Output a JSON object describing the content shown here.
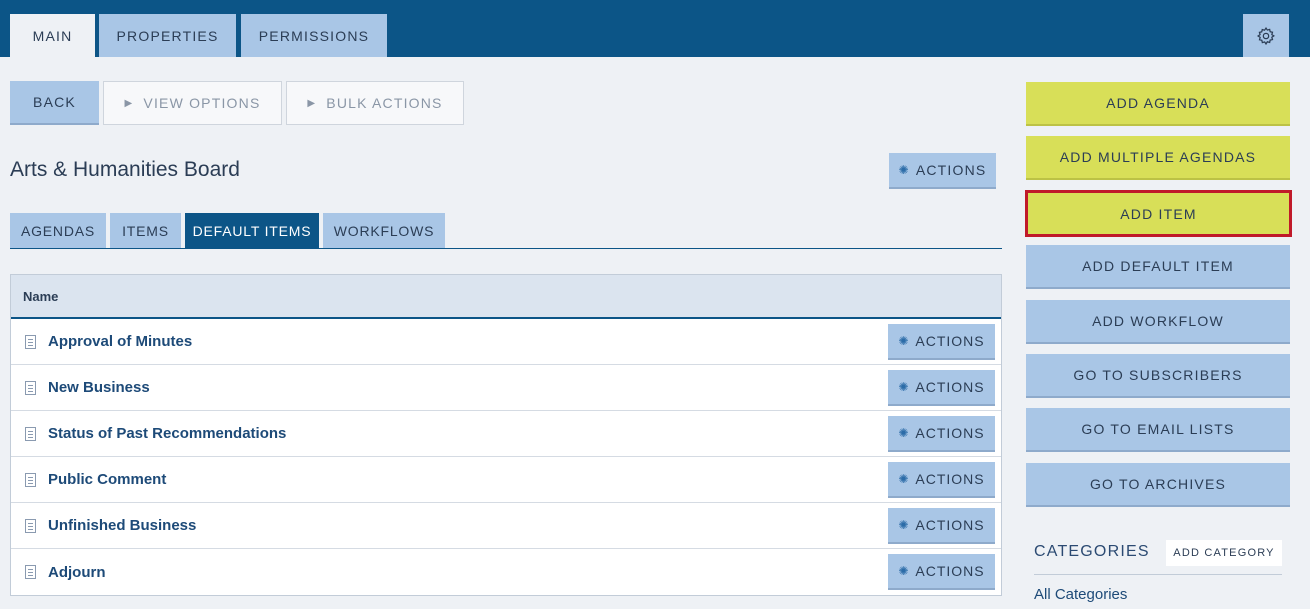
{
  "top_tabs": [
    "MAIN",
    "PROPERTIES",
    "PERMISSIONS"
  ],
  "toolbar": {
    "back_label": "BACK",
    "view_options_label": "VIEW OPTIONS",
    "bulk_actions_label": "BULK ACTIONS"
  },
  "page": {
    "title": "Arts & Humanities Board",
    "actions_label": "ACTIONS"
  },
  "sub_tabs": [
    "AGENDAS",
    "ITEMS",
    "DEFAULT ITEMS",
    "WORKFLOWS"
  ],
  "active_sub_tab": "DEFAULT ITEMS",
  "table": {
    "header_name": "Name",
    "action_label": "ACTIONS",
    "rows": [
      "Approval of Minutes",
      "New Business",
      "Status of Past Recommendations",
      "Public Comment",
      "Unfinished Business",
      "Adjourn"
    ]
  },
  "sidebar": {
    "buttons": [
      "ADD AGENDA",
      "ADD MULTIPLE AGENDAS",
      "ADD ITEM",
      "ADD DEFAULT ITEM",
      "ADD WORKFLOW",
      "GO TO SUBSCRIBERS",
      "GO TO EMAIL LISTS",
      "GO TO ARCHIVES"
    ],
    "selected_button": "ADD ITEM",
    "categories_title": "CATEGORIES",
    "add_category_label": "ADD CATEGORY",
    "all_categories_label": "All Categories"
  },
  "icons": {
    "settings": "gear-icon",
    "actions": "cog-icon",
    "document": "document-icon",
    "expand": "triangle-right-icon"
  },
  "colors": {
    "header_bg": "#0c5587",
    "button_blue": "#a9c6e6",
    "button_yellow": "#d8df58",
    "selected_border": "#c01a2a"
  }
}
